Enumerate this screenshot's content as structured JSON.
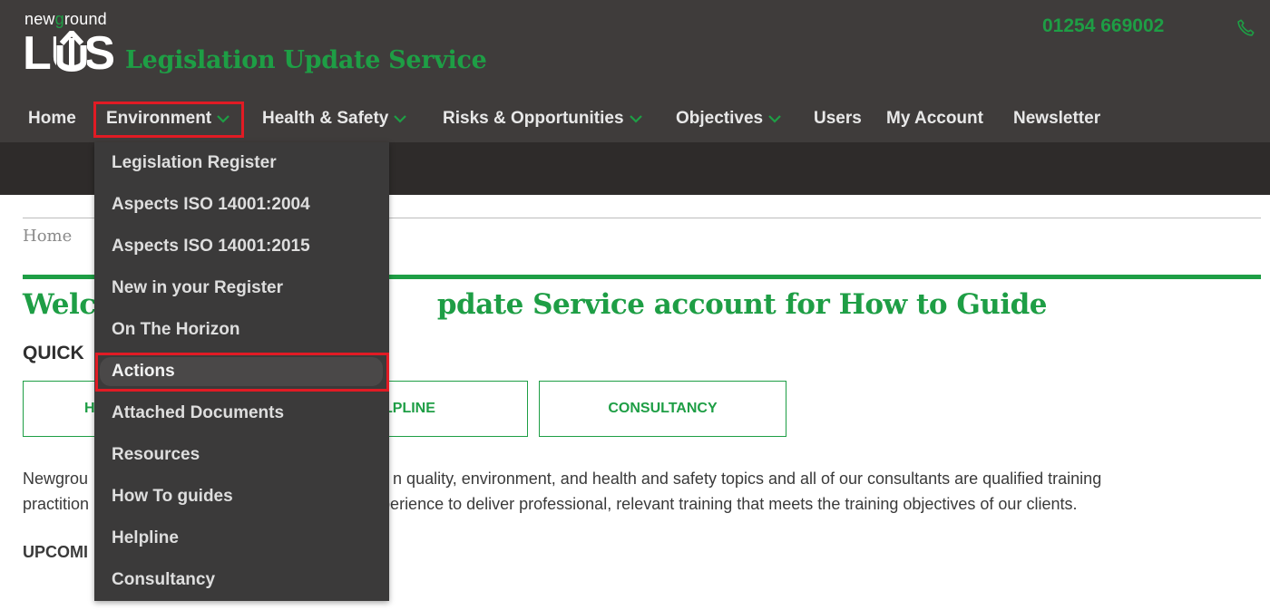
{
  "brand": {
    "logo_new": "new",
    "logo_g": "g",
    "logo_round": "round",
    "logo_lus": "LUS",
    "site_title": "Legislation Update Service",
    "phone": "01254 669002"
  },
  "nav": {
    "items": [
      {
        "label": "Home"
      },
      {
        "label": "Environment"
      },
      {
        "label": "Health & Safety"
      },
      {
        "label": "Risks & Opportunities"
      },
      {
        "label": "Objectives"
      },
      {
        "label": "Users"
      },
      {
        "label": "My Account"
      },
      {
        "label": "Newsletter"
      }
    ]
  },
  "dropdown": {
    "items": [
      {
        "label": "Legislation Register"
      },
      {
        "label": "Aspects ISO 14001:2004"
      },
      {
        "label": "Aspects ISO 14001:2015"
      },
      {
        "label": "New in your Register"
      },
      {
        "label": "On The Horizon"
      },
      {
        "label": "Actions"
      },
      {
        "label": "Attached Documents"
      },
      {
        "label": "Resources"
      },
      {
        "label": "How To guides"
      },
      {
        "label": "Helpline"
      },
      {
        "label": "Consultancy"
      }
    ],
    "active": "Actions"
  },
  "content": {
    "breadcrumb": "Home",
    "welcome_start": "Welco",
    "welcome_end": "pdate Service account for How to Guide",
    "quick_heading": "QUICK",
    "quick_buttons": [
      {
        "label": "H"
      },
      {
        "label": "LPLINE"
      },
      {
        "label": "CONSULTANCY"
      }
    ],
    "para_line1_start": "Newgrou",
    "para_line1_end": "n quality, environment, and health and safety topics and all of our consultants are qualified training",
    "para_line2_start": "practition",
    "para_line2_end": "perience to deliver professional, relevant training that meets the training objectives of our clients.",
    "upcoming": "UPCOMI"
  },
  "colors": {
    "brand_green": "#1e9e45",
    "header_bg": "#3f3c3b",
    "dropdown_bg": "#3b3a3a",
    "highlight_red": "#e11b24"
  }
}
